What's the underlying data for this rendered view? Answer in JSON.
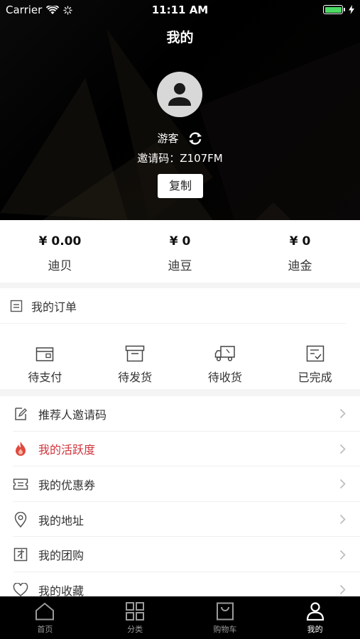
{
  "status_bar": {
    "carrier": "Carrier",
    "time": "11:11 AM"
  },
  "header": {
    "title": "我的"
  },
  "profile": {
    "username": "游客",
    "invite_code": "邀请码：Z107FM",
    "copy_label": "复制"
  },
  "balance": [
    {
      "value": "¥ 0.00",
      "label": "迪贝"
    },
    {
      "value": "¥ 0",
      "label": "迪豆"
    },
    {
      "value": "¥ 0",
      "label": "迪金"
    }
  ],
  "orders": {
    "title": "我的订单",
    "items": [
      {
        "label": "待支付",
        "icon": "wallet-icon"
      },
      {
        "label": "待发货",
        "icon": "box-icon"
      },
      {
        "label": "待收货",
        "icon": "truck-icon"
      },
      {
        "label": "已完成",
        "icon": "checklist-icon"
      }
    ]
  },
  "menu": [
    {
      "label": "推荐人邀请码",
      "icon": "edit-icon"
    },
    {
      "label": "我的活跃度",
      "icon": "flame-icon",
      "color": "#d0353d"
    },
    {
      "label": "我的优惠券",
      "icon": "coupon-icon"
    },
    {
      "label": "我的地址",
      "icon": "location-icon"
    },
    {
      "label": "我的团购",
      "icon": "group-buy-icon"
    },
    {
      "label": "我的收藏",
      "icon": "heart-icon"
    }
  ],
  "tabbar": [
    {
      "label": "首页",
      "icon": "home-icon"
    },
    {
      "label": "分类",
      "icon": "grid-icon"
    },
    {
      "label": "购物车",
      "icon": "cart-icon"
    },
    {
      "label": "我的",
      "icon": "person-icon",
      "active": true
    }
  ],
  "colors": {
    "accent_red": "#d0353d",
    "battery_green": "#4cd964",
    "header_bg": "#000000"
  }
}
